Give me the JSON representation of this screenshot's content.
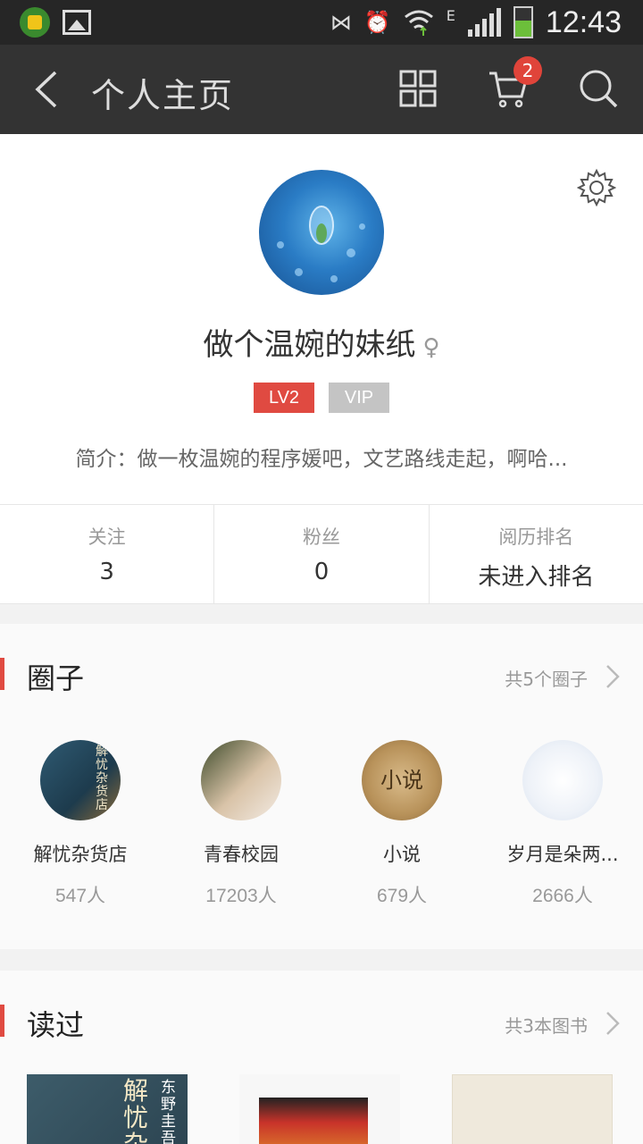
{
  "status_bar": {
    "time": "12:43",
    "network": "E"
  },
  "nav": {
    "title": "个人主页",
    "cart_count": "2"
  },
  "profile": {
    "username": "做个温婉的妹纸",
    "gender_symbol": "♀",
    "level_badge": "LV2",
    "vip_badge": "VIP",
    "intro": "简介：做一枚温婉的程序媛吧，文艺路线走起，啊哈..."
  },
  "stats": [
    {
      "label": "关注",
      "value": "3"
    },
    {
      "label": "粉丝",
      "value": "0"
    },
    {
      "label": "阅历排名",
      "value": "未进入排名"
    }
  ],
  "circles": {
    "title": "圈子",
    "more": "共5个圈子",
    "items": [
      {
        "name": "解忧杂货店",
        "count": "547人",
        "cover_text": "解忧杂货店"
      },
      {
        "name": "青春校园",
        "count": "17203人"
      },
      {
        "name": "小说",
        "count": "679人",
        "cover_text": "小说"
      },
      {
        "name": "岁月是朵两...",
        "count": "2666人"
      }
    ]
  },
  "books": {
    "title": "读过",
    "more": "共3本图书",
    "items": [
      {
        "cover_title": "解忧杂货",
        "cover_author": "东野圭吾"
      },
      {},
      {}
    ]
  },
  "colors": {
    "accent": "#e04a41",
    "nav_bg": "#333333",
    "vip_badge": "#c4c4c4"
  }
}
